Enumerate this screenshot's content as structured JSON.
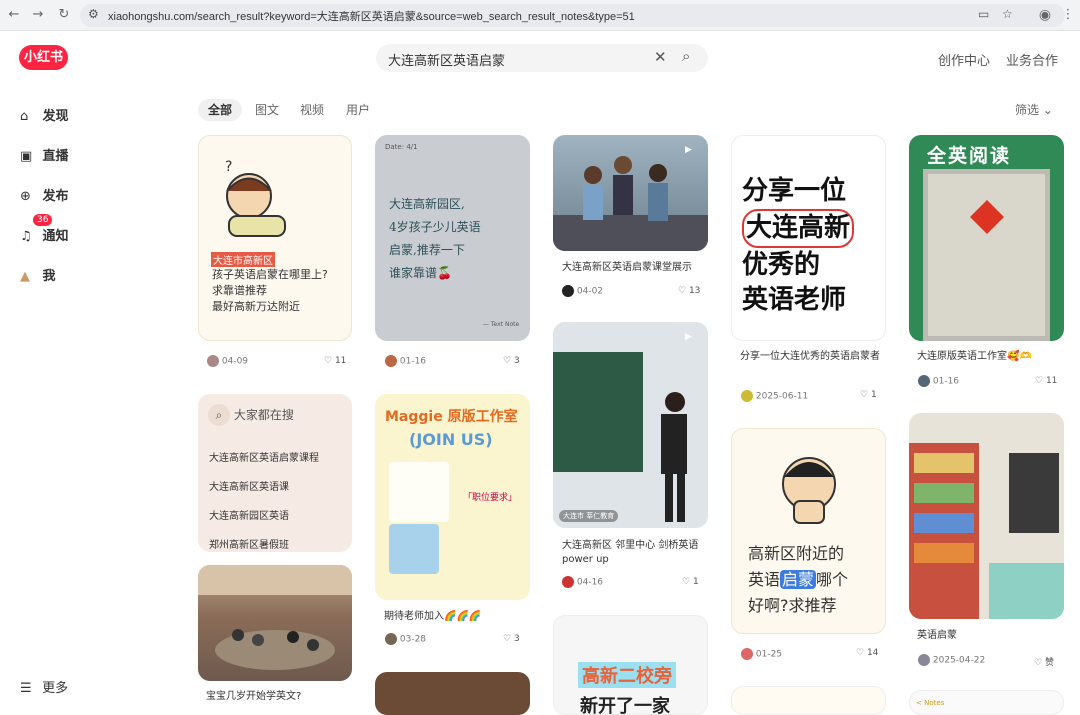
{
  "browser": {
    "url": "xiaohongshu.com/search_result?keyword=大连高新区英语启蒙&source=web_search_result_notes&type=51"
  },
  "header": {
    "logo": "小红书",
    "search_value": "大连高新区英语启蒙",
    "links": [
      "创作中心",
      "业务合作"
    ]
  },
  "sidebar": {
    "items": [
      "发现",
      "直播",
      "发布",
      "通知",
      "我"
    ],
    "badge": "36",
    "more": "更多"
  },
  "tabs": {
    "items": [
      "全部",
      "图文",
      "视频",
      "用户"
    ],
    "filter": "筛选"
  },
  "cards": [
    {
      "tag": "大连市高新区",
      "lines": [
        "孩子英语启蒙在哪里上?",
        "求靠谱推荐",
        "最好高新万达附近"
      ],
      "date": "04-09",
      "likes": "11"
    },
    {
      "note": [
        "大连高新园区,",
        "4岁孩子少儿英语",
        "启蒙,推荐一下",
        "谁家靠谱🍒"
      ],
      "note_date": "Date: 4/1",
      "note_footer": "— Text Note",
      "date": "01-16",
      "likes": "3"
    },
    {
      "caption": "大连高新区英语启蒙课堂展示",
      "date": "04-02",
      "likes": "13"
    },
    {
      "big": [
        "分享一位",
        "大连高新",
        "优秀的",
        "英语老师"
      ],
      "caption": "分享一位大连优秀的英语启蒙者",
      "date": "2025-06-11",
      "likes": "1"
    },
    {
      "sign": "全英阅读",
      "caption": "大连原版英语工作室🥰🫶",
      "date": "01-16",
      "likes": "11"
    },
    {
      "title": "大家都在搜",
      "items": [
        "大连高新区英语启蒙课程",
        "大连高新区英语课",
        "大连高新园区英语",
        "郑州高新区暑假班"
      ]
    },
    {
      "poster_title": "Maggie 原版工作室",
      "poster_sub": "(JOIN US)",
      "req": "「职位要求」",
      "caption": "期待老师加入🌈🌈🌈",
      "date": "03-28",
      "likes": "3"
    },
    {
      "video_label": "大连市 莘仁教育",
      "caption": [
        "大连高新区 邻里中心 剑桥英语",
        "power up"
      ],
      "date": "04-16",
      "likes": "1"
    },
    {
      "big2": [
        "高新区附近的",
        "英语",
        "启蒙",
        "哪个",
        "好啊?求推荐"
      ],
      "date": "01-25",
      "likes": "14"
    },
    {
      "caption": "英语启蒙",
      "date": "2025-04-22",
      "likes": "赞"
    },
    {
      "caption": "宝宝几岁开始学英文?"
    },
    {
      "big3": [
        "高新二校旁",
        "新开了一家"
      ]
    },
    {
      "notes_label": "< Notes"
    }
  ]
}
